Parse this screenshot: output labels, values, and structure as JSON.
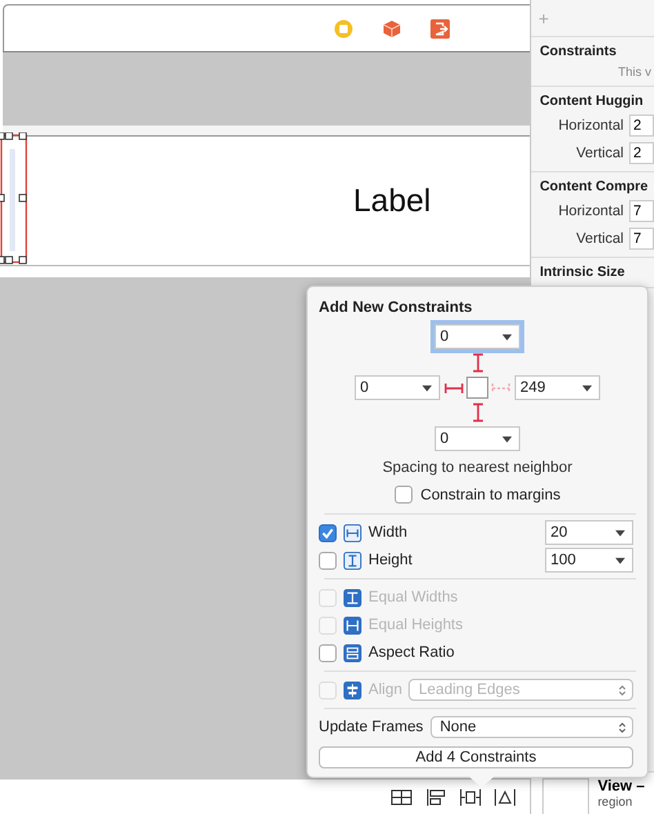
{
  "canvas": {
    "label": "Label"
  },
  "inspector": {
    "add": "+",
    "sections": [
      {
        "title": "Constraints",
        "note": "This v"
      },
      {
        "title": "Content Huggin",
        "rows": [
          {
            "label": "Horizontal",
            "value": "2"
          },
          {
            "label": "Vertical",
            "value": "2"
          }
        ]
      },
      {
        "title": "Content Compre",
        "rows": [
          {
            "label": "Horizontal",
            "value": "7"
          },
          {
            "label": "Vertical",
            "value": "7"
          }
        ]
      },
      {
        "title": "Intrinsic Size"
      }
    ],
    "footer": {
      "title": "View –",
      "subtitle": "region"
    }
  },
  "popover": {
    "title": "Add New Constraints",
    "spacing": {
      "top": {
        "value": "0",
        "active": true,
        "focused": true
      },
      "left": {
        "value": "0",
        "active": true,
        "focused": false
      },
      "right": {
        "value": "249",
        "active": false,
        "focused": false
      },
      "bottom": {
        "value": "0",
        "active": true,
        "focused": false
      }
    },
    "spacing_caption": "Spacing to nearest neighbor",
    "margins": {
      "label": "Constrain to margins",
      "checked": false
    },
    "options": [
      {
        "kind": "width",
        "label": "Width",
        "checked": true,
        "disabled": false,
        "value": "20"
      },
      {
        "kind": "height",
        "label": "Height",
        "checked": false,
        "disabled": false,
        "value": "100"
      },
      {
        "kind": "equal-widths",
        "label": "Equal Widths",
        "checked": false,
        "disabled": true
      },
      {
        "kind": "equal-heights",
        "label": "Equal Heights",
        "checked": false,
        "disabled": true
      },
      {
        "kind": "aspect-ratio",
        "label": "Aspect Ratio",
        "checked": false,
        "disabled": false
      },
      {
        "kind": "align",
        "label": "Align",
        "checked": false,
        "disabled": true,
        "value": "Leading Edges"
      }
    ],
    "update_frames": {
      "label": "Update Frames",
      "value": "None"
    },
    "button": "Add 4 Constraints"
  }
}
